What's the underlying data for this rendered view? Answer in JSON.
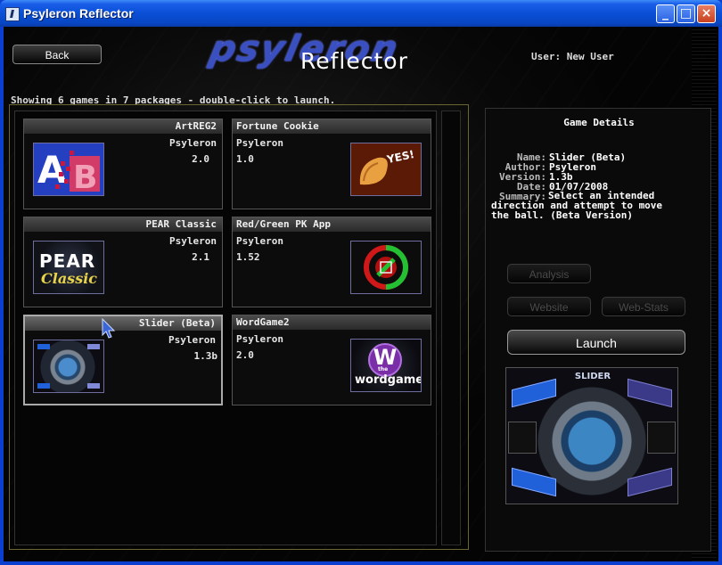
{
  "window": {
    "title": "Psyleron Reflector",
    "minimize_glyph": "_",
    "maximize_glyph": "□",
    "close_glyph": "×"
  },
  "header": {
    "back_label": "Back",
    "logo_top": "psyleron",
    "logo_bottom": "Reflector",
    "user_text": "User: New User"
  },
  "status": "Showing 6 games in 7 packages - double-click to launch.",
  "games": [
    {
      "name": "ArtREG2",
      "author": "Psyleron",
      "version": "2.0",
      "thumb_icon": "artreg-logo"
    },
    {
      "name": "Fortune Cookie",
      "author": "Psyleron",
      "version": "1.0",
      "thumb_icon": "fortune-cookie-logo",
      "thumb_text": "YES!"
    },
    {
      "name": "PEAR Classic",
      "author": "Psyleron",
      "version": "2.1",
      "thumb_icon": "pear-classic-logo",
      "thumb_text": "PEAR",
      "thumb_text2": "Classic"
    },
    {
      "name": "Red/Green PK App",
      "author": "Psyleron",
      "version": "1.52",
      "thumb_icon": "red-green-pk-logo"
    },
    {
      "name": "Slider (Beta)",
      "author": "Psyleron",
      "version": "1.3b",
      "thumb_icon": "slider-thumbnail",
      "selected": true
    },
    {
      "name": "WordGame2",
      "author": "Psyleron",
      "version": "2.0",
      "thumb_icon": "wordgame-logo",
      "thumb_text": "W",
      "thumb_text2": "wordgame",
      "thumb_text3": "the"
    }
  ],
  "details": {
    "title": "Game Details",
    "name_label": "Name:",
    "name_value": "Slider (Beta)",
    "author_label": "Author:",
    "author_value": "Psyleron",
    "version_label": "Version:",
    "version_value": "1.3b",
    "date_label": "Date:",
    "date_value": "01/07/2008",
    "summary_label": "Summary:",
    "summary_value": "Select an intended direction and attempt to move the ball. (Beta Version)",
    "analysis_label": "Analysis",
    "website_label": "Website",
    "webstats_label": "Web-Stats",
    "launch_label": "Launch",
    "preview_title": "SLIDER"
  },
  "colors": {
    "titlebar_blue": "#0a4fd6",
    "background": "#080808",
    "logo_blue": "#3a4fc0",
    "panel_border": "#555555"
  }
}
